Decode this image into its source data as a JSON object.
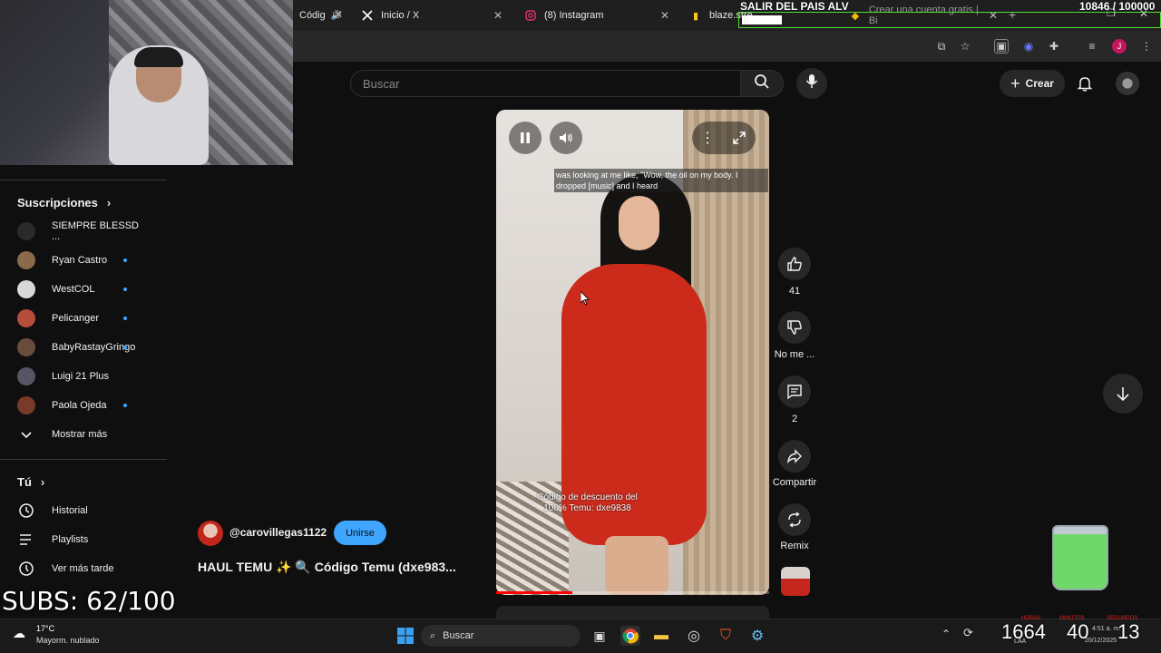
{
  "browser": {
    "tabs": [
      {
        "label": "Códig",
        "icon": "youtube-icon"
      },
      {
        "label": "Inicio / X",
        "icon": "x-logo-icon"
      },
      {
        "label": "(8) Instagram",
        "icon": "instagram-icon"
      },
      {
        "label": "blaze.stre",
        "icon": "blaze-icon"
      },
      {
        "label": "Crear una cuenta gratis | Bi",
        "icon": "binance-icon"
      }
    ]
  },
  "stream_overlay": {
    "title": "SALIR DEL PAIS ALV",
    "goal": "10846  / 100000",
    "subs": "SUBS: 62/100",
    "counter_main": "1664",
    "counter_a": "40",
    "counter_b": "13",
    "counter_labels": [
      "HORAS",
      "MINUTOS",
      "SEGUNDOS"
    ]
  },
  "header": {
    "search_placeholder": "Buscar",
    "create_label": "Crear"
  },
  "sidebar": {
    "subs_heading": "Suscripciones",
    "subscriptions": [
      {
        "name": "SIEMPRE BLESSD ...",
        "color": "#2a2a2a",
        "new": false
      },
      {
        "name": "Ryan Castro",
        "color": "#8a6a4a",
        "new": true
      },
      {
        "name": "WestCOL",
        "color": "#d9d9d9",
        "new": true
      },
      {
        "name": "Pelicanger",
        "color": "#b64c3c",
        "new": true
      },
      {
        "name": "BabyRastayGringo",
        "color": "#6a4c3c",
        "new": true
      },
      {
        "name": "Luigi 21 Plus",
        "color": "#555566",
        "new": false
      },
      {
        "name": "Paola Ojeda",
        "color": "#7a3a2a",
        "new": true
      }
    ],
    "show_more": "Mostrar más",
    "you_heading": "Tú",
    "you_items": [
      {
        "label": "Historial",
        "icon": "history-icon"
      },
      {
        "label": "Playlists",
        "icon": "playlist-icon"
      },
      {
        "label": "Ver más tarde",
        "icon": "clock-icon"
      }
    ]
  },
  "video": {
    "caption": "was looking at me like, \"Wow, the oil on my body. I dropped [music] and I heard",
    "overlay_text": "Código de descuento del 100% Temu: dxe9838",
    "progress": 0.28
  },
  "actions": {
    "likes": "41",
    "dislike_label": "No me ...",
    "comments": "2",
    "share_label": "Compartir",
    "remix_label": "Remix"
  },
  "channel": {
    "handle": "@carovillegas1122",
    "join_label": "Unirse",
    "title": "HAUL TEMU ✨ 🔍 Código Temu (dxe983..."
  },
  "taskbar": {
    "weather_temp": "17°C",
    "weather_desc": "Mayorm. nublado",
    "search_label": "Buscar",
    "time": "4:51 a. m.",
    "date": "20/12/2025",
    "lang": "LAA"
  }
}
